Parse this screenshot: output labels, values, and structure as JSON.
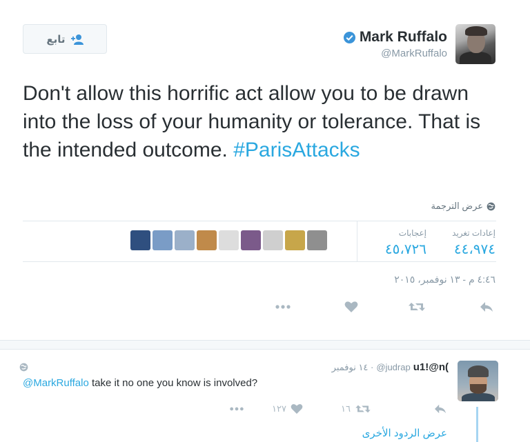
{
  "tweet": {
    "author_name": "Mark Ruffalo",
    "author_handle": "@MarkRuffalo",
    "follow_label": "تابع",
    "text_main": "Don't allow this horrific act allow you to be drawn into the loss of your humanity or tolerance. That is the intended outcome.",
    "hashtag": "#ParisAttacks",
    "translate_label": "عرض الترجمة",
    "retweets_label": "إعادات تغريد",
    "retweets_count": "٤٤،٩٧٤",
    "likes_label": "إعجابات",
    "likes_count": "٤٥،٧٢٦",
    "timestamp": "٤:٤٦ م - ١٣ نوفمبر، ٢٠١٥",
    "liker_colors": [
      "#2f4f7f",
      "#7a9cc6",
      "#9bb0c9",
      "#c08a4a",
      "#dddddd",
      "#7b5a8a",
      "#cfcfcf",
      "#c7a64a",
      "#8f8f8f"
    ]
  },
  "reply": {
    "name": "u1!@n(",
    "handle": "@judrap",
    "time": "· ١٤ نوفمبر",
    "mention": "@MarkRuffalo",
    "text": " take it no one you know is involved?",
    "retweet_count": "١٦",
    "like_count": "١٢٧",
    "more_replies_label": "عرض الردود الأخرى"
  },
  "colors": {
    "accent": "#2aa8e0",
    "muted": "#8899a6",
    "verified": "#3b94d9"
  }
}
